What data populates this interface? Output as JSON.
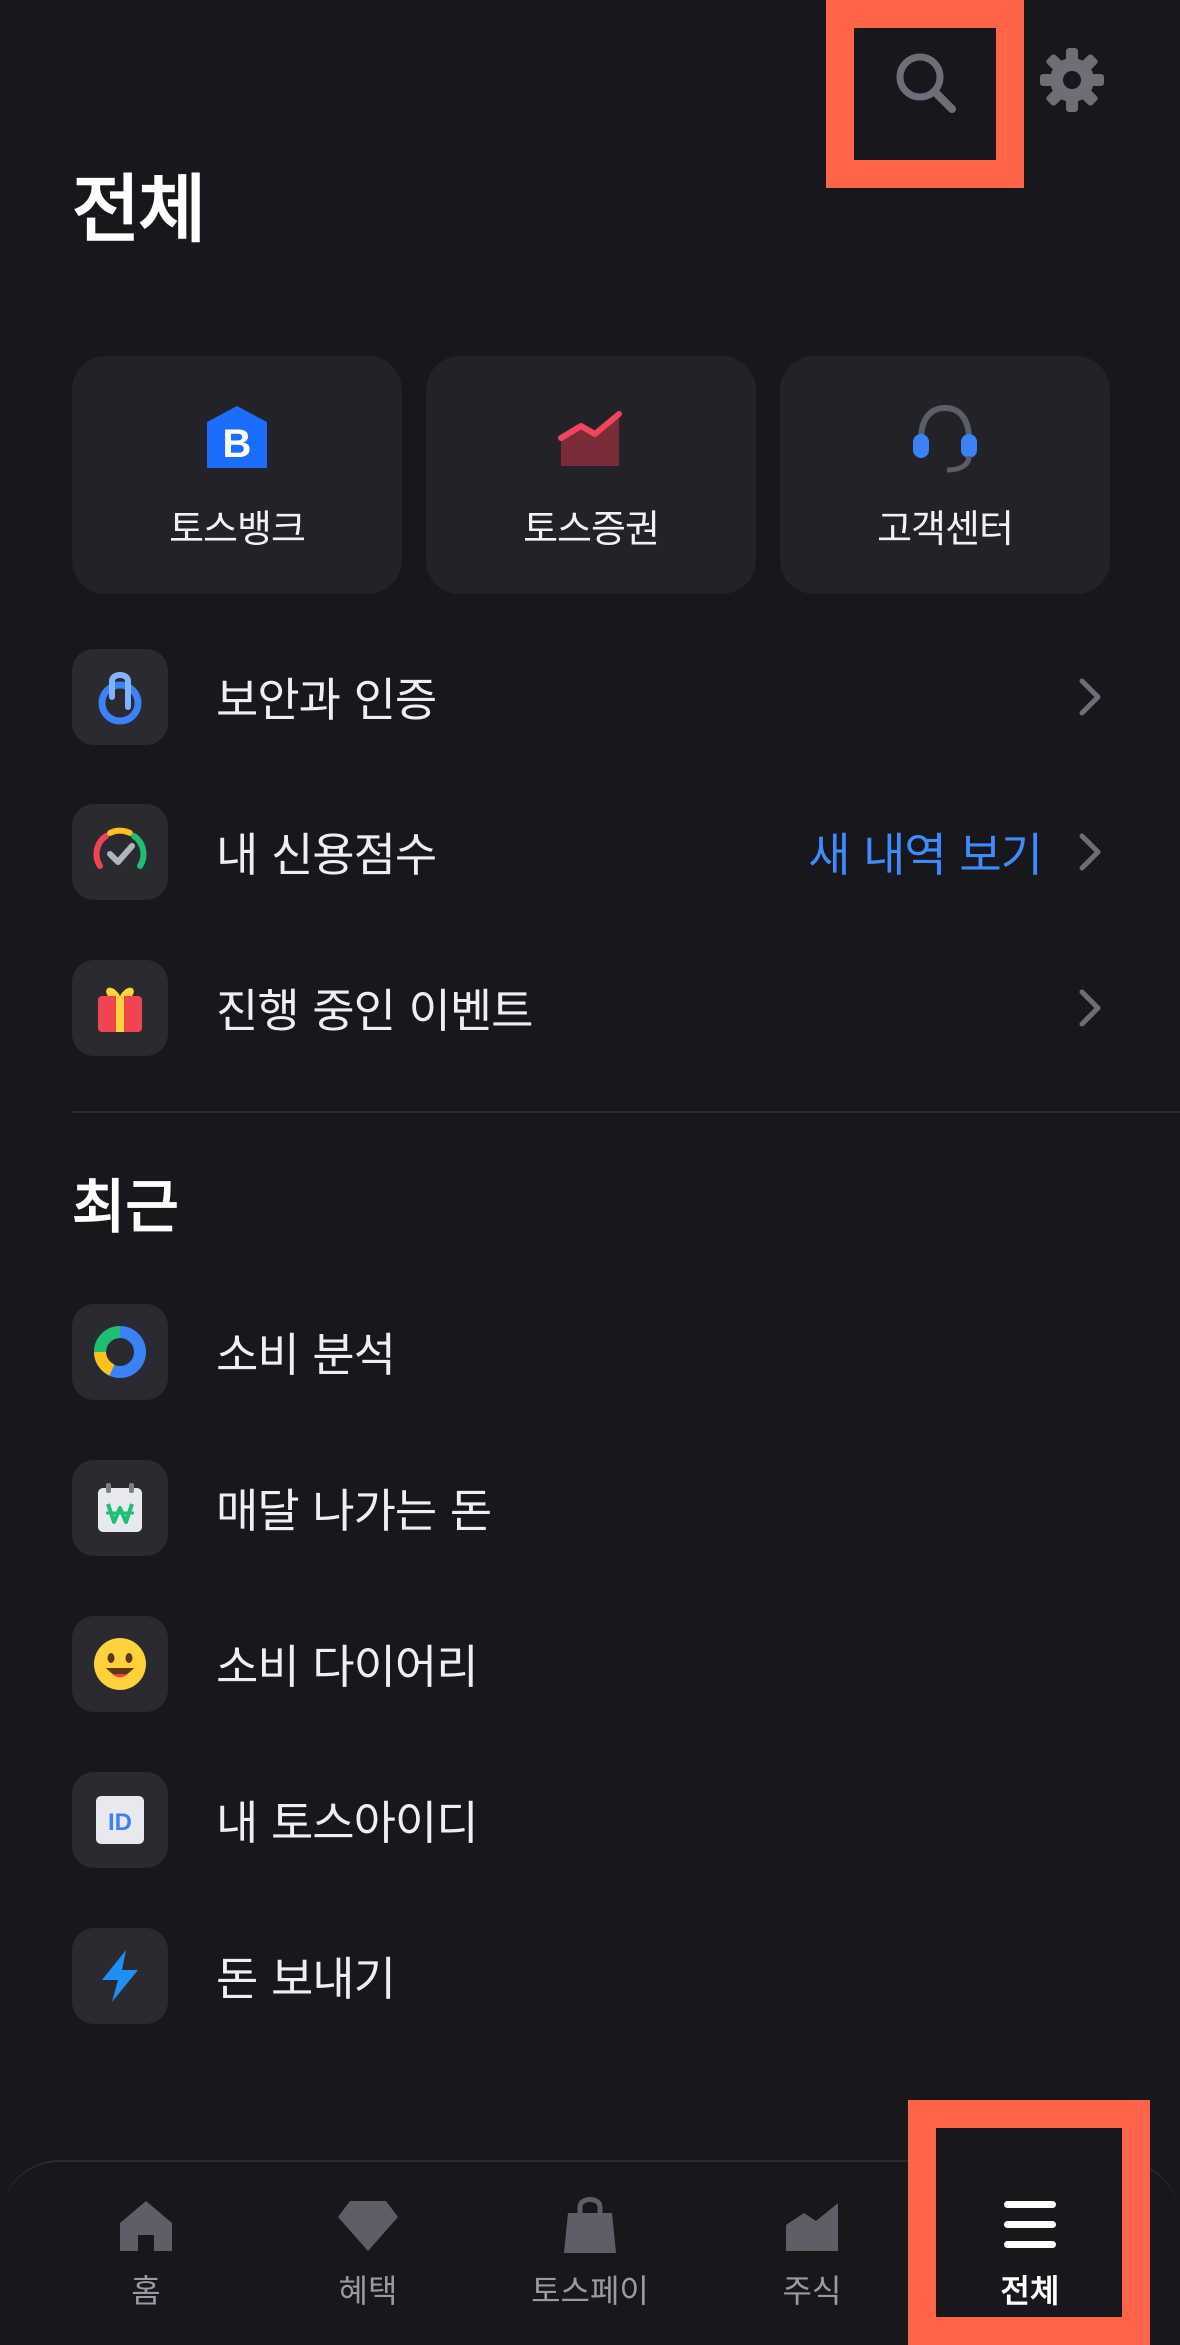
{
  "header": {
    "title": "전체",
    "search_icon": "search-icon",
    "settings_icon": "gear-icon"
  },
  "quick_cards": [
    {
      "label": "토스뱅크",
      "icon": "bank-b-icon"
    },
    {
      "label": "토스증권",
      "icon": "stock-chart-icon"
    },
    {
      "label": "고객센터",
      "icon": "headset-icon"
    }
  ],
  "menu": [
    {
      "label": "보안과 인증",
      "icon": "security-lock-icon",
      "extra": ""
    },
    {
      "label": "내 신용점수",
      "icon": "credit-gauge-icon",
      "extra": "새 내역 보기"
    },
    {
      "label": "진행 중인 이벤트",
      "icon": "gift-icon",
      "extra": ""
    }
  ],
  "recent": {
    "title": "최근",
    "items": [
      {
        "label": "소비 분석",
        "icon": "donut-chart-icon"
      },
      {
        "label": "매달 나가는 돈",
        "icon": "calendar-won-icon"
      },
      {
        "label": "소비 다이어리",
        "icon": "smile-icon"
      },
      {
        "label": "내 토스아이디",
        "icon": "id-card-icon"
      },
      {
        "label": "돈 보내기",
        "icon": "lightning-icon"
      }
    ]
  },
  "bottom_nav": [
    {
      "label": "홈",
      "icon": "home-icon",
      "active": false
    },
    {
      "label": "혜택",
      "icon": "diamond-icon",
      "active": false
    },
    {
      "label": "토스페이",
      "icon": "shopping-bag-icon",
      "active": false
    },
    {
      "label": "주식",
      "icon": "chart-icon",
      "active": false
    },
    {
      "label": "전체",
      "icon": "menu-icon",
      "active": true
    }
  ],
  "colors": {
    "background": "#18171c",
    "card": "#222228",
    "accent_blue": "#3c8cff",
    "highlight": "#ff6448"
  }
}
